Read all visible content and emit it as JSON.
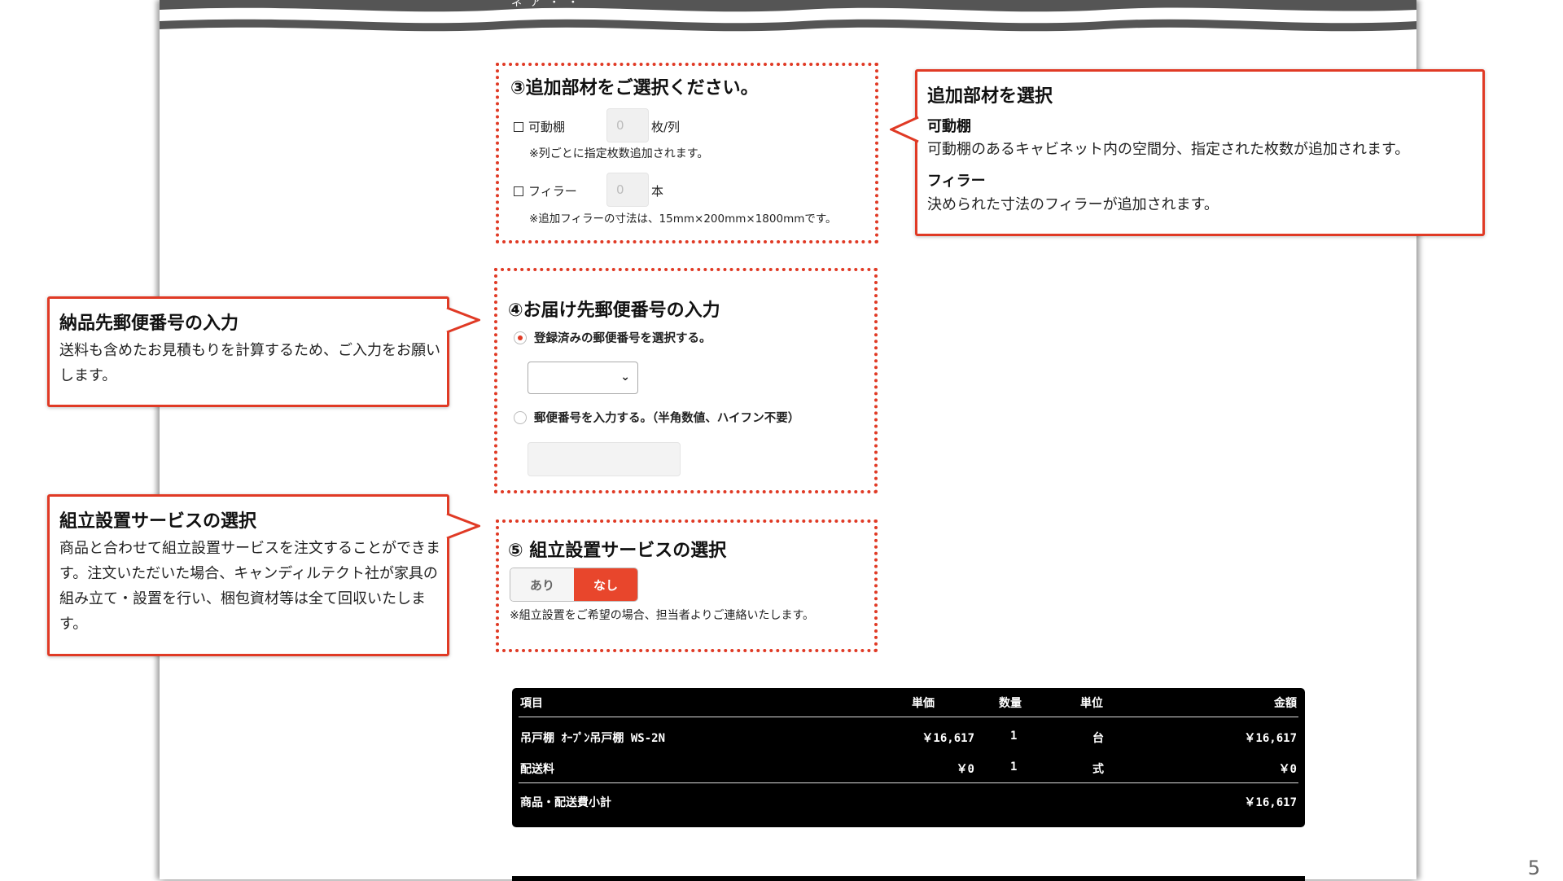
{
  "header_partial_text": "ネ ア ・ ・",
  "section3": {
    "title": "③追加部材をご選択ください。",
    "shelf_label": "可動棚",
    "shelf_value": "0",
    "shelf_unit": "枚/列",
    "shelf_note": "※列ごとに指定枚数追加されます。",
    "filler_label": "フィラー",
    "filler_value": "0",
    "filler_unit": "本",
    "filler_note": "※追加フィラーの寸法は、15mm×200mm×1800mmです。"
  },
  "section4": {
    "title": "④お届け先郵便番号の入力",
    "option_registered": "登録済みの郵便番号を選択する。",
    "option_input": "郵便番号を入力する。（半角数値、ハイフン不要）",
    "selected_option": "registered",
    "select_value": "",
    "zip_value": ""
  },
  "section5": {
    "title": "⑤ 組立設置サービスの選択",
    "option_yes": "あり",
    "option_no": "なし",
    "selected": "なし",
    "note": "※組立設置をご希望の場合、担当者よりご連絡いたします。"
  },
  "callouts": {
    "parts": {
      "title": "追加部材を選択",
      "sub1": "可動棚",
      "text1": "可動棚のあるキャビネット内の空間分、指定された枚数が追加されます。",
      "sub2": "フィラー",
      "text2": "決められた寸法のフィラーが追加されます。"
    },
    "zip": {
      "title": "納品先郵便番号の入力",
      "text": "送料も含めたお見積もりを計算するため、ご入力をお願いします。"
    },
    "assembly": {
      "title": "組立設置サービスの選択",
      "text": "商品と合わせて組立設置サービスを注文することができます。注文いただいた場合、キャンディルテクト社が家具の組み立て・設置を行い、梱包資材等は全て回収いたします。"
    }
  },
  "price_table": {
    "headers": {
      "item": "項目",
      "unit_price": "単価",
      "qty": "数量",
      "unit": "単位",
      "amount": "金額"
    },
    "rows": [
      {
        "item": "吊戸棚 ｵｰﾌﾟﾝ吊戸棚 WS-2N",
        "unit_price": "￥16,617",
        "qty": "1",
        "unit": "台",
        "amount": "￥16,617"
      },
      {
        "item": "配送料",
        "unit_price": "￥0",
        "qty": "1",
        "unit": "式",
        "amount": "￥0"
      }
    ],
    "subtotal_label": "商品・配送費小計",
    "subtotal_amount": "￥16,617"
  },
  "page_number": "5",
  "colors": {
    "accent": "#e03a25",
    "segment_on": "#e8462c",
    "table_bg": "#000000"
  }
}
